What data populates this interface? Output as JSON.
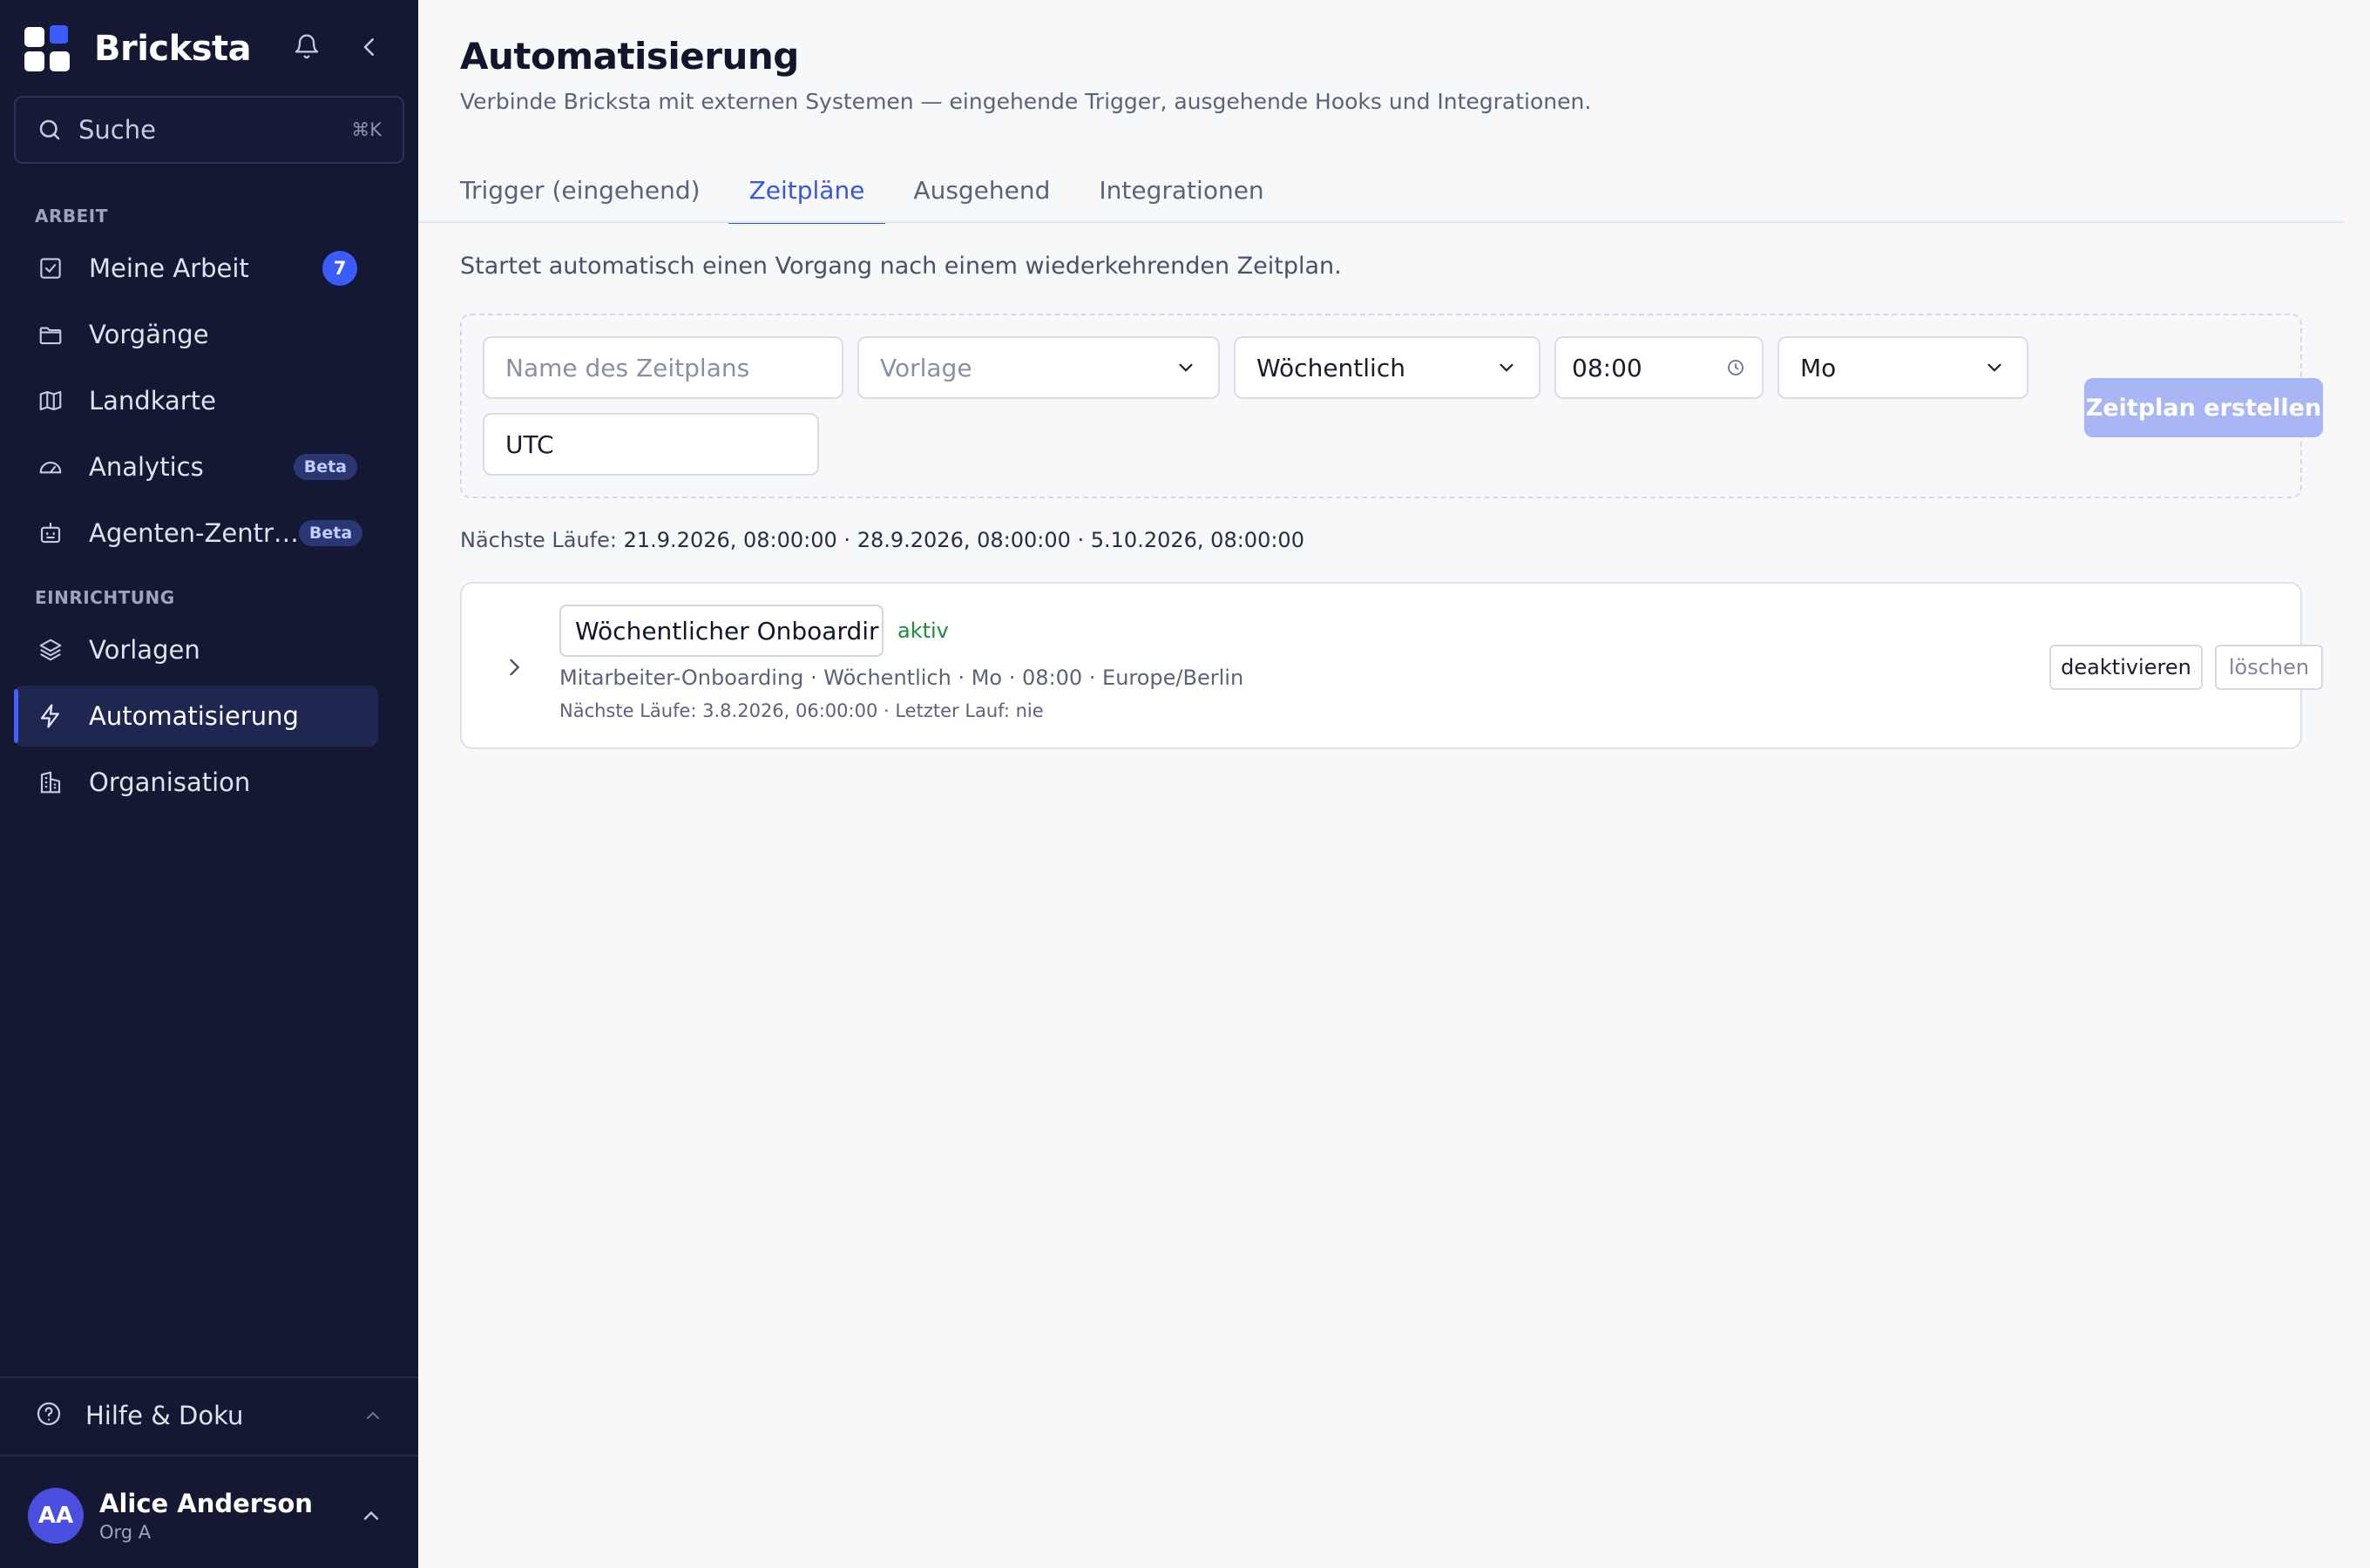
{
  "brand": {
    "name": "Bricksta"
  },
  "search": {
    "label": "Suche",
    "shortcut": "⌘K"
  },
  "sidebar": {
    "section_work": "ARBEIT",
    "section_setup": "EINRICHTUNG",
    "items": [
      {
        "label": "Meine Arbeit",
        "icon": "check-square-icon",
        "badge": "7"
      },
      {
        "label": "Vorgänge",
        "icon": "folder-icon"
      },
      {
        "label": "Landkarte",
        "icon": "map-icon"
      },
      {
        "label": "Analytics",
        "icon": "gauge-icon",
        "badge": "Beta"
      },
      {
        "label": "Agenten-Zentr…",
        "icon": "robot-icon",
        "badge": "Beta"
      },
      {
        "label": "Vorlagen",
        "icon": "layers-icon"
      },
      {
        "label": "Automatisierung",
        "icon": "lightning-icon",
        "active": true
      },
      {
        "label": "Organisation",
        "icon": "building-icon"
      }
    ],
    "help": "Hilfe & Doku",
    "user": {
      "initials": "AA",
      "name": "Alice Anderson",
      "org": "Org A"
    }
  },
  "page": {
    "title": "Automatisierung",
    "subtitle": "Verbinde Bricksta mit externen Systemen — eingehende Trigger, ausgehende Hooks und Integrationen.",
    "tabs": [
      {
        "label": "Trigger (eingehend)"
      },
      {
        "label": "Zeitpläne",
        "active": true
      },
      {
        "label": "Ausgehend"
      },
      {
        "label": "Integrationen"
      }
    ],
    "intro": "Startet automatisch einen Vorgang nach einem wiederkehrenden Zeitplan."
  },
  "form": {
    "name_placeholder": "Name des Zeitplans",
    "template_placeholder": "Vorlage",
    "frequency": "Wöchentlich",
    "time": "08:00",
    "weekday": "Mo",
    "timezone": "UTC",
    "create_label": "Zeitplan erstellen"
  },
  "next_runs": {
    "label": "Nächste Läufe:",
    "values": "21.9.2026, 08:00:00 · 28.9.2026, 08:00:00 · 5.10.2026, 08:00:00"
  },
  "schedule": {
    "name": "Wöchentlicher Onboardir",
    "status": "aktiv",
    "meta": "Mitarbeiter-Onboarding · Wöchentlich · Mo · 08:00 · Europe/Berlin",
    "runs": "Nächste Läufe: 3.8.2026, 06:00:00 · Letzter Lauf: nie",
    "deactivate_label": "deaktivieren",
    "delete_label": "löschen"
  },
  "colors": {
    "sidebar_bg": "#141832",
    "accent": "#3a55e0",
    "status_active": "#1f8a3a",
    "button_disabled": "#a9b6f5"
  }
}
